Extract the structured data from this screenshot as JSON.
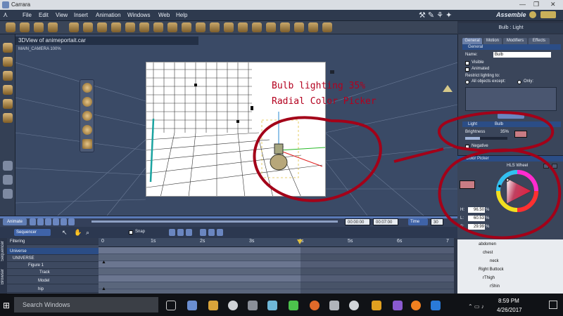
{
  "window": {
    "title": "Carrara",
    "minimize": "—",
    "maximize": "❐",
    "close": "✕"
  },
  "menu": {
    "items": [
      "File",
      "Edit",
      "View",
      "Insert",
      "Animation",
      "Windows",
      "Web",
      "Help"
    ],
    "room": "Assemble"
  },
  "viewport": {
    "tab_title": "3DView of animeportait.car",
    "camera": "MAIN_CAMERA 100%"
  },
  "annotation": {
    "line1": "Bulb lighting 35%",
    "line2": "Radial Color Picker"
  },
  "timeline": {
    "animate_label": "Animate",
    "time_current": "00:00:00",
    "time_end": "00:07:00",
    "time_unit": "Time",
    "fps": "30",
    "sequencer_label": "Sequencer",
    "snap_label": "Snap",
    "filtering_label": "Filtering",
    "ticks": [
      "0",
      "1s",
      "2s",
      "3s",
      "4s",
      "5s",
      "6s",
      "7"
    ],
    "tree_rows": [
      "Universe",
      "UNIVERSE",
      "Figure 1",
      "Track",
      "Model",
      "hip"
    ],
    "side_labels": [
      "Sequencer",
      "Browser"
    ]
  },
  "properties": {
    "title": "Bulb : Light",
    "tabs": [
      "General",
      "Motion",
      "Modifiers",
      "Effects"
    ],
    "section_general": "General",
    "name_label": "Name:",
    "name_value": "Bulb",
    "visible_label": "Visible",
    "animated_label": "Animated",
    "restrict_label": "Restrict lighting to:",
    "all_except_label": "All objects except:",
    "only_label": "Only:",
    "light_label": "Light",
    "light_value": "Bulb",
    "brightness_label": "Brightness",
    "brightness_value": "35%",
    "brightness_level": 0.35,
    "negative_label": "Negative"
  },
  "color_picker": {
    "title": "Color Picker",
    "mode": "HLS Wheel",
    "h_label": "H:",
    "h_value": "96.50",
    "h_unit": "%",
    "l_label": "L:",
    "l_value": "60.53",
    "l_unit": "%",
    "s_label": "S:",
    "s_value": "29.99",
    "s_unit": "%",
    "swatch_color": "#c97c84"
  },
  "scene_tree": {
    "items": [
      "abdomen",
      "chest",
      "neck",
      "Right Buttock",
      "rThigh",
      "rShin"
    ]
  },
  "taskbar": {
    "search_placeholder": "Search Windows",
    "time": "8:59 PM",
    "date": "4/26/2017"
  },
  "colors": {
    "annotation": "#b3001e",
    "accent": "#5f7cb3",
    "menubar": "#2e3a4e"
  }
}
